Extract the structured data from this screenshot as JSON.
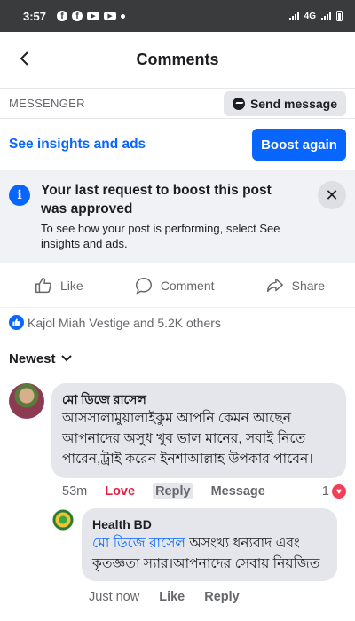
{
  "status_bar": {
    "time": "3:57",
    "network": "4G"
  },
  "header": {
    "title": "Comments"
  },
  "messenger": {
    "label": "MESSENGER",
    "send_label": "Send message"
  },
  "boost": {
    "insights_label": "See insights and ads",
    "boost_label": "Boost again"
  },
  "notice": {
    "title": "Your last request to boost this post was approved",
    "text": "To see how your post is performing, select See insights and ads."
  },
  "actions": {
    "like": "Like",
    "comment": "Comment",
    "share": "Share"
  },
  "reactions": {
    "summary": "Kajol Miah Vestige and 5.2K others"
  },
  "sort": {
    "label": "Newest"
  },
  "comment": {
    "author": "মো ডিজে রাসেল",
    "text": "আসসালামুয়ালাইকুম আপনি কেমন আছেন আপনাদের অসুধ খুব ভাল মানের, সবাই নিতে পারেন,ট্রাই করেন ইনশাআল্লাহ উপকার পাবেন।",
    "time": "53m",
    "love": "Love",
    "reply": "Reply",
    "message": "Message",
    "reaction_count": "1"
  },
  "reply": {
    "author": "Health BD",
    "mention": "মো ডিজে রাসেল",
    "text": " অসংখ্য ধন্যবাদ এবং কৃতজ্ঞতা স্যার।আপনাদের সেবায় নিয়জিত",
    "time": "Just now",
    "like": "Like",
    "reply": "Reply"
  },
  "colors": {
    "accent": "#0866ff",
    "love": "#e41e3f",
    "bubble": "#e4e6eb"
  },
  "icons": [
    "back-arrow-icon",
    "messenger-icon",
    "info-icon",
    "close-icon",
    "like-icon",
    "comment-icon",
    "share-icon",
    "chevron-down-icon",
    "heart-icon"
  ]
}
